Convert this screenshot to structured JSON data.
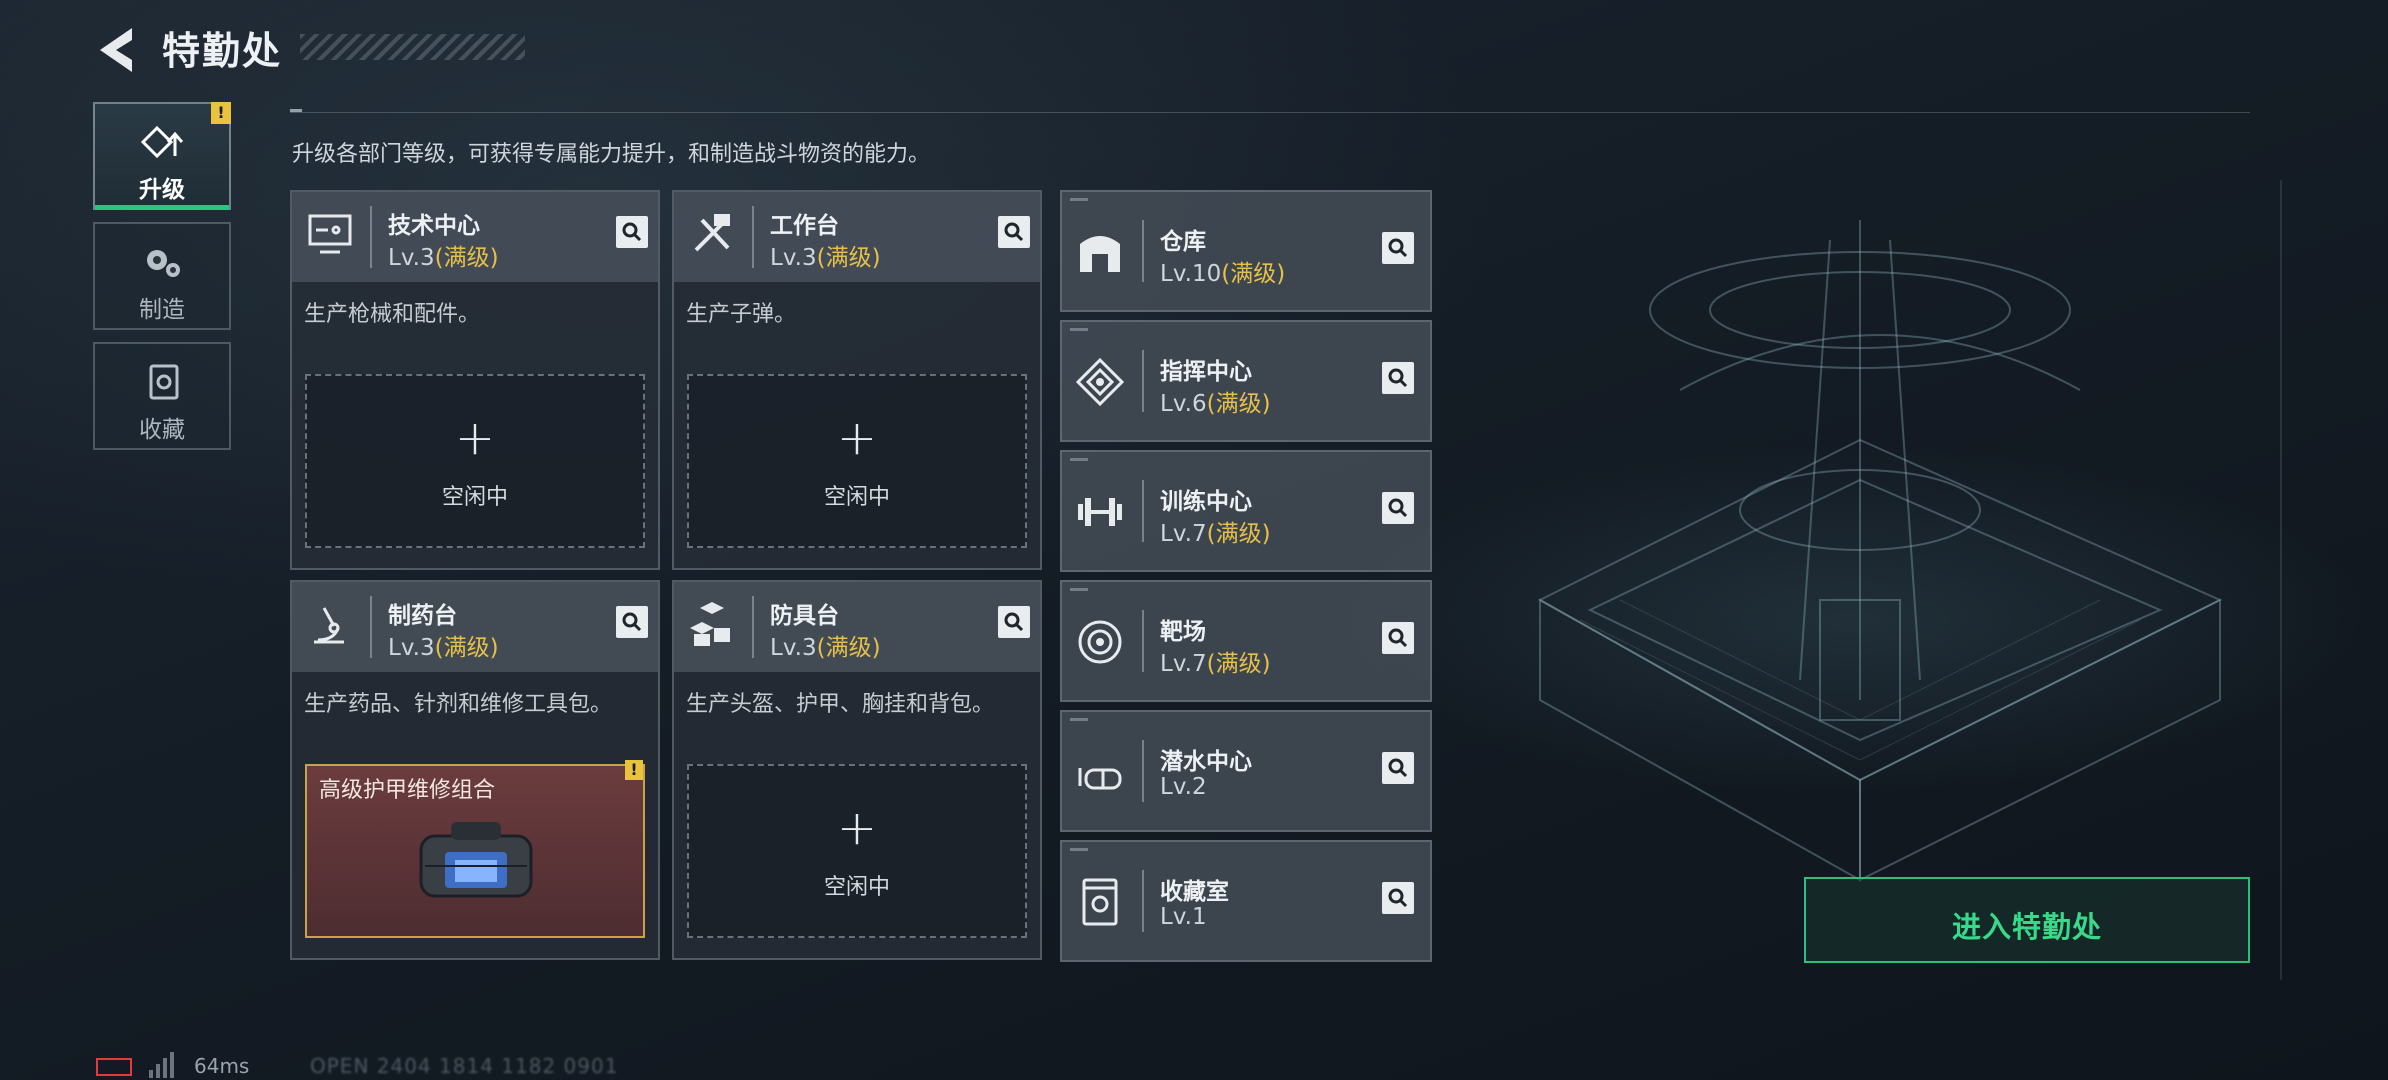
{
  "header": {
    "title": "特勤处"
  },
  "sidebar": {
    "items": [
      {
        "label": "升级",
        "icon": "upgrade-icon",
        "active": true,
        "badge": "!"
      },
      {
        "label": "制造",
        "icon": "gears-icon",
        "active": false
      },
      {
        "label": "收藏",
        "icon": "collection-icon",
        "active": false
      }
    ]
  },
  "description": "升级各部门等级，可获得专属能力提升，和制造战斗物资的能力。",
  "workshops": [
    {
      "name": "技术中心",
      "level": "Lv.3",
      "max": "(满级)",
      "icon": "monitor-icon",
      "desc": "生产枪械和配件。",
      "slot": {
        "plus": "+",
        "status": "空闲中"
      }
    },
    {
      "name": "工作台",
      "level": "Lv.3",
      "max": "(满级)",
      "icon": "tools-icon",
      "desc": "生产子弹。",
      "slot": {
        "plus": "+",
        "status": "空闲中"
      }
    },
    {
      "name": "制药台",
      "level": "Lv.3",
      "max": "(满级)",
      "icon": "microscope-icon",
      "desc": "生产药品、针剂和维修工具包。",
      "slot": {
        "job": "高级护甲维修组合",
        "badge": "!"
      }
    },
    {
      "name": "防具台",
      "level": "Lv.3",
      "max": "(满级)",
      "icon": "cubes-icon",
      "desc": "生产头盔、护甲、胸挂和背包。",
      "slot": {
        "plus": "+",
        "status": "空闲中"
      }
    }
  ],
  "facilities": [
    {
      "name": "仓库",
      "level": "Lv.10",
      "max": "(满级)",
      "icon": "warehouse-icon"
    },
    {
      "name": "指挥中心",
      "level": "Lv.6",
      "max": "(满级)",
      "icon": "command-icon"
    },
    {
      "name": "训练中心",
      "level": "Lv.7",
      "max": "(满级)",
      "icon": "dumbbell-icon"
    },
    {
      "name": "靶场",
      "level": "Lv.7",
      "max": "(满级)",
      "icon": "target-icon"
    },
    {
      "name": "潜水中心",
      "level": "Lv.2",
      "max": "",
      "icon": "diving-mask-icon"
    },
    {
      "name": "收藏室",
      "level": "Lv.1",
      "max": "",
      "icon": "display-case-icon"
    }
  ],
  "enter_button": "进入特勤处",
  "status": {
    "ping": "64ms",
    "uid": "OPEN 2404 1814 1182 0901"
  },
  "colors": {
    "accent_green": "#2fbf78",
    "max_level": "#e6c04b",
    "warning": "#e9c33c"
  }
}
